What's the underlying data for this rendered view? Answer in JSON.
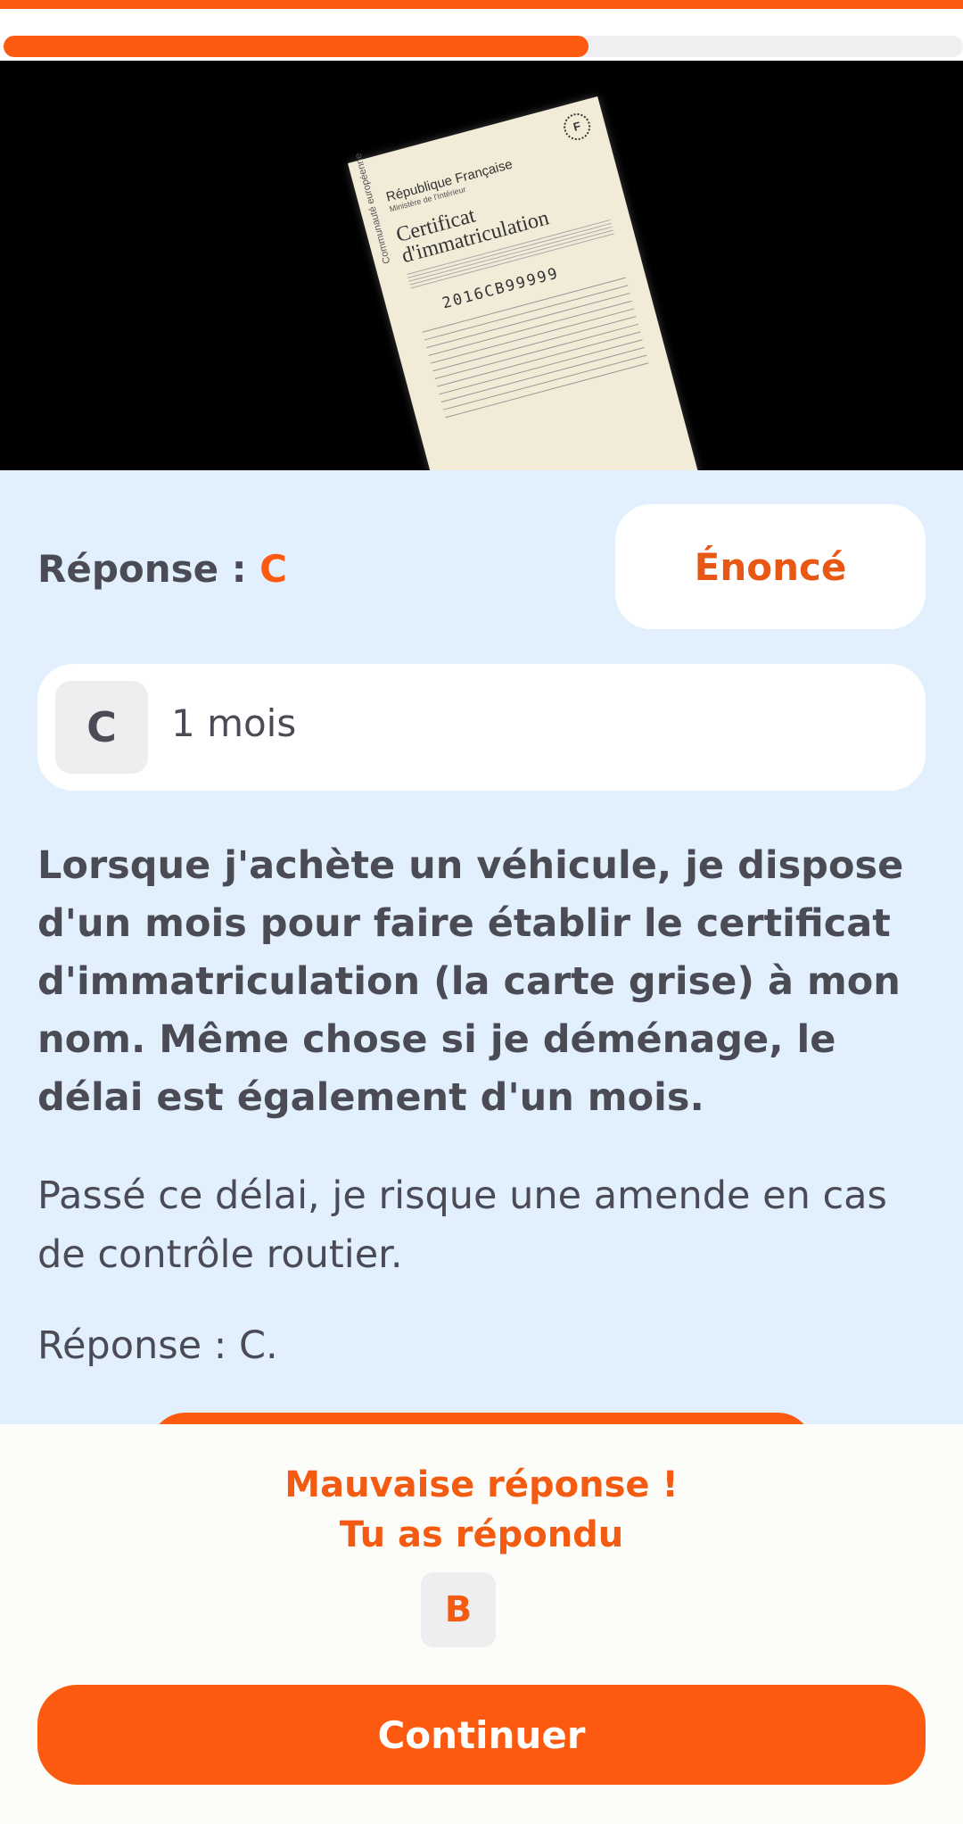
{
  "progress": {
    "fraction": 0.61
  },
  "image": {
    "doc_country": "République Française",
    "doc_ministry": "Ministère de l'Intérieur",
    "doc_title": "Certificat d'immatriculation",
    "doc_number": "2016CB99999",
    "doc_side": "Communauté européenne",
    "doc_flag": "F"
  },
  "answer": {
    "label": "Réponse : ",
    "letter": "C"
  },
  "enonce_button": "Énoncé",
  "choice": {
    "letter": "C",
    "text": "1 mois"
  },
  "explanation": {
    "bold": "Lorsque j'achète un véhicule, je dispose d'un mois pour faire établir le certificat d'immatriculation (la carte grise) à mon nom. Même chose si je déménage, le délai est également d'un mois.",
    "para2": "Passé ce délai, je risque une amende en cas de contrôle routier.",
    "para3": "Réponse : C."
  },
  "result": {
    "line1": "Mauvaise réponse !",
    "line2": "Tu as répondu",
    "given_letter": "B"
  },
  "continue_button": "Continuer",
  "colors": {
    "accent": "#fb5a10",
    "background": "#e2effd",
    "text": "#4b4b55"
  }
}
